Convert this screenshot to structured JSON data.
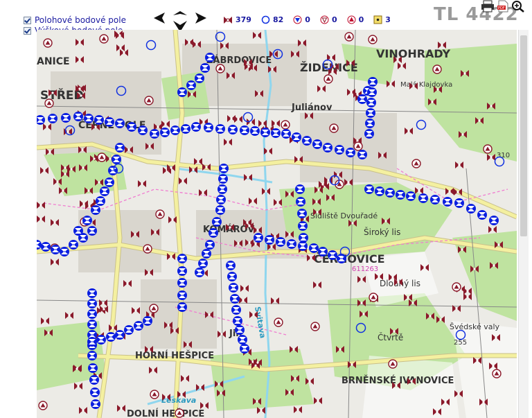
{
  "layers": [
    {
      "label": "Polohové bodové pole",
      "checked": true
    },
    {
      "label": "Výškové bodové pole",
      "checked": true
    }
  ],
  "counts": [
    {
      "icon": "trig-point-icon",
      "value": "379",
      "color": "#8b1a2b"
    },
    {
      "icon": "circle-point-icon",
      "value": "82",
      "color": "#1030e0"
    },
    {
      "icon": "triangle-down-point-icon",
      "value": "0",
      "color": "#c01030"
    },
    {
      "icon": "shield-point-icon",
      "value": "0",
      "color": "#c01030"
    },
    {
      "icon": "triangle-up-point-icon",
      "value": "0",
      "color": "#c01030"
    },
    {
      "icon": "square-point-icon",
      "value": "3",
      "color": "#8b1a2b"
    }
  ],
  "sheet_label": "TL 4422",
  "map": {
    "labels": [
      {
        "text": "VINOHRADY"
      },
      {
        "text": "ŽIDENICE"
      },
      {
        "text": "ZÁBRDOVICE"
      },
      {
        "text": "STŘED"
      },
      {
        "text": "ČERNÉ POLE"
      },
      {
        "text": "KOMÁROV"
      },
      {
        "text": "ČERNOVICE"
      },
      {
        "text": "HORNÍ HEŠPICE"
      },
      {
        "text": "DOLNÍ HEŠPICE"
      },
      {
        "text": "BRNĚNSKÉ IVANOVICE"
      },
      {
        "text": "Široký lis"
      },
      {
        "text": "Dlouhý lis"
      },
      {
        "text": "Čtvrtě"
      },
      {
        "text": "Švédské valy"
      },
      {
        "text": "Svitava"
      },
      {
        "text": "Leskava"
      },
      {
        "text": "Malá Klajdovka"
      },
      {
        "text": "Juliánov"
      },
      {
        "text": "Sídliště Dvouřadé"
      },
      {
        "text": "Jih"
      },
      {
        "text": "611263"
      },
      {
        "text": "255"
      },
      {
        "text": "310"
      },
      {
        "text": "ANICE"
      }
    ]
  },
  "colors": {
    "trig": "#8b1a2b",
    "circle": "#1030e0",
    "leveling": "#0a1ee0",
    "road": "#f4f0a0",
    "green": "#bfe3a0",
    "water": "#8fd6ee",
    "pink": "#f07cd0"
  }
}
